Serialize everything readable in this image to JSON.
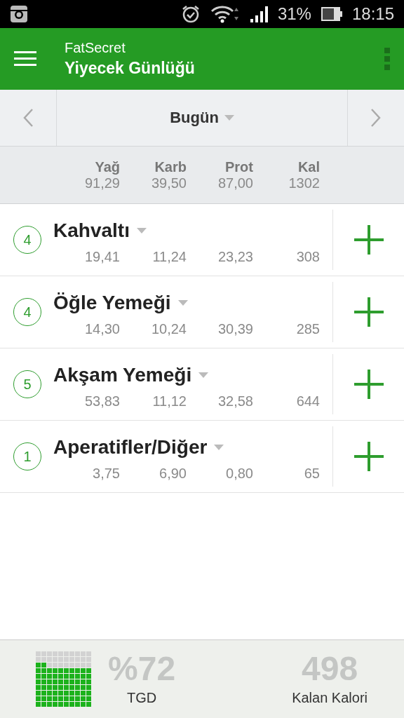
{
  "status_bar": {
    "battery": "31%",
    "time": "18:15"
  },
  "app_bar": {
    "app_name": "FatSecret",
    "title": "Yiyecek Günlüğü"
  },
  "date_nav": {
    "label": "Bugün"
  },
  "totals": {
    "columns": [
      "Yağ",
      "Karb",
      "Prot",
      "Kal"
    ],
    "values": [
      "91,29",
      "39,50",
      "87,00",
      "1302"
    ]
  },
  "meals": [
    {
      "count": "4",
      "name": "Kahvaltı",
      "values": [
        "19,41",
        "11,24",
        "23,23",
        "308"
      ]
    },
    {
      "count": "4",
      "name": "Öğle Yemeği",
      "values": [
        "14,30",
        "10,24",
        "30,39",
        "285"
      ]
    },
    {
      "count": "5",
      "name": "Akşam Yemeği",
      "values": [
        "53,83",
        "11,12",
        "32,58",
        "644"
      ]
    },
    {
      "count": "1",
      "name": "Aperatifler/Diğer",
      "values": [
        "3,75",
        "6,90",
        "0,80",
        "65"
      ]
    }
  ],
  "summary": {
    "percent": "%72",
    "percent_label": "TGD",
    "remaining": "498",
    "remaining_label": "Kalan Kalori"
  }
}
